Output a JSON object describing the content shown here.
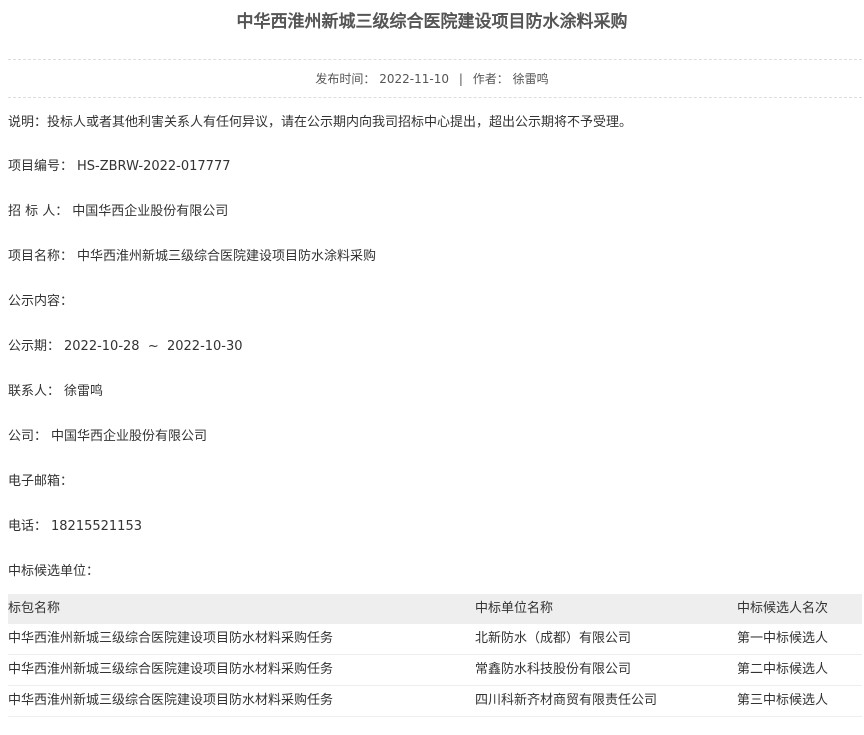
{
  "title": "中华西淮州新城三级综合医院建设项目防水涂料采购",
  "meta": {
    "publish_label": "发布时间：",
    "publish_date": "2022-11-10",
    "separator": "|",
    "author_label": "作者：",
    "author": "徐雷鸣"
  },
  "note": "说明：投标人或者其他利害关系人有任何异议，请在公示期内向我司招标中心提出，超出公示期将不予受理。",
  "fields": {
    "project_no": {
      "label": "项目编号：",
      "value": "HS-ZBRW-2022-017777"
    },
    "tenderer": {
      "label": "招 标 人：",
      "value": "中国华西企业股份有限公司"
    },
    "project_name": {
      "label": "项目名称：",
      "value": "中华西淮州新城三级综合医院建设项目防水涂料采购"
    },
    "content": {
      "label": "公示内容：",
      "value": ""
    },
    "period": {
      "label": "公示期：",
      "value": "2022-10-28  ~  2022-10-30"
    },
    "contact": {
      "label": "联系人：",
      "value": "徐雷鸣"
    },
    "company": {
      "label": "公司：",
      "value": "中国华西企业股份有限公司"
    },
    "email": {
      "label": "电子邮箱：",
      "value": ""
    },
    "phone": {
      "label": "电话：",
      "value": "18215521153"
    }
  },
  "candidates_label": "中标候选单位：",
  "table": {
    "headers": [
      "标包名称",
      "中标单位名称",
      "中标候选人名次"
    ],
    "rows": [
      [
        "中华西淮州新城三级综合医院建设项目防水材料采购任务",
        "北新防水（成都）有限公司",
        "第一中标候选人"
      ],
      [
        "中华西淮州新城三级综合医院建设项目防水材料采购任务",
        "常鑫防水科技股份有限公司",
        "第二中标候选人"
      ],
      [
        "中华西淮州新城三级综合医院建设项目防水材料采购任务",
        "四川科新齐材商贸有限责任公司",
        "第三中标候选人"
      ]
    ]
  }
}
